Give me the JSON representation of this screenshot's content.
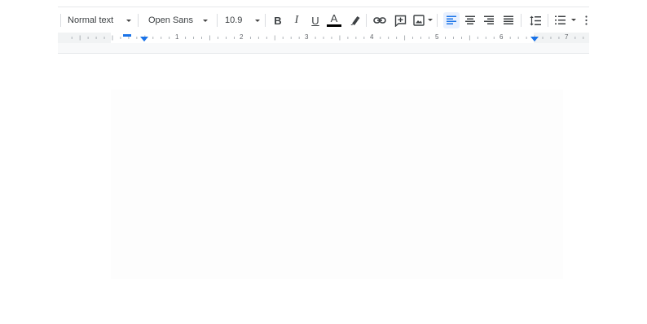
{
  "toolbar": {
    "style_select": {
      "value": "Normal text"
    },
    "font_select": {
      "value": "Open Sans"
    },
    "size_select": {
      "value": "10.9"
    },
    "bold_label": "B",
    "italic_label": "I",
    "underline_label": "U",
    "text_color_label": "A",
    "text_color": "#000000",
    "icons": [
      "highlighter-icon",
      "link-icon",
      "insert-comment-icon",
      "insert-image-icon",
      "align-left-icon",
      "align-center-icon",
      "align-right-icon",
      "align-justify-icon",
      "line-spacing-icon",
      "numbered-list-icon",
      "more-icon"
    ],
    "active_alignment": "left"
  },
  "ruler": {
    "numbers": [
      "1",
      "2",
      "3",
      "4",
      "5",
      "6",
      "7"
    ]
  },
  "colors": {
    "accent": "#1a73e8",
    "icon": "#3c4043",
    "ruler_bg": "#f1f3f4"
  }
}
